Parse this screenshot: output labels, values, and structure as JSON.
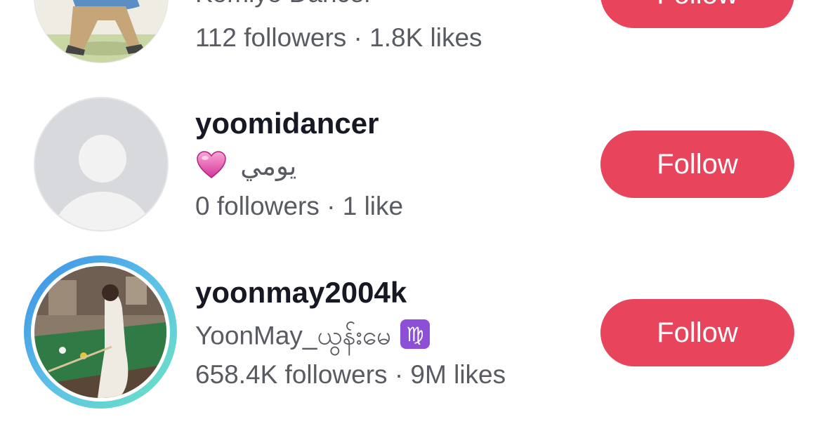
{
  "users": [
    {
      "nickname": "Komiyo Dancer",
      "stats": "112 followers · 1.8K likes",
      "follow_label": "Follow"
    },
    {
      "username": "yoomidancer",
      "nickname": "يومي",
      "nickname_emoji": "heart-emoji",
      "stats": "0 followers · 1 like",
      "follow_label": "Follow"
    },
    {
      "username": "yoonmay2004k",
      "nickname": "YoonMay_ယွန်းမေ",
      "nickname_emoji": "virgo-emoji",
      "stats": "658.4K followers · 9M likes",
      "follow_label": "Follow"
    }
  ],
  "colors": {
    "follow_button": "#e8455d",
    "username_text": "#161823",
    "secondary_text": "#595b63",
    "default_avatar_bg": "#d8d9dc",
    "story_ring_start": "#3a8ee6",
    "story_ring_end": "#6ee6c0"
  }
}
